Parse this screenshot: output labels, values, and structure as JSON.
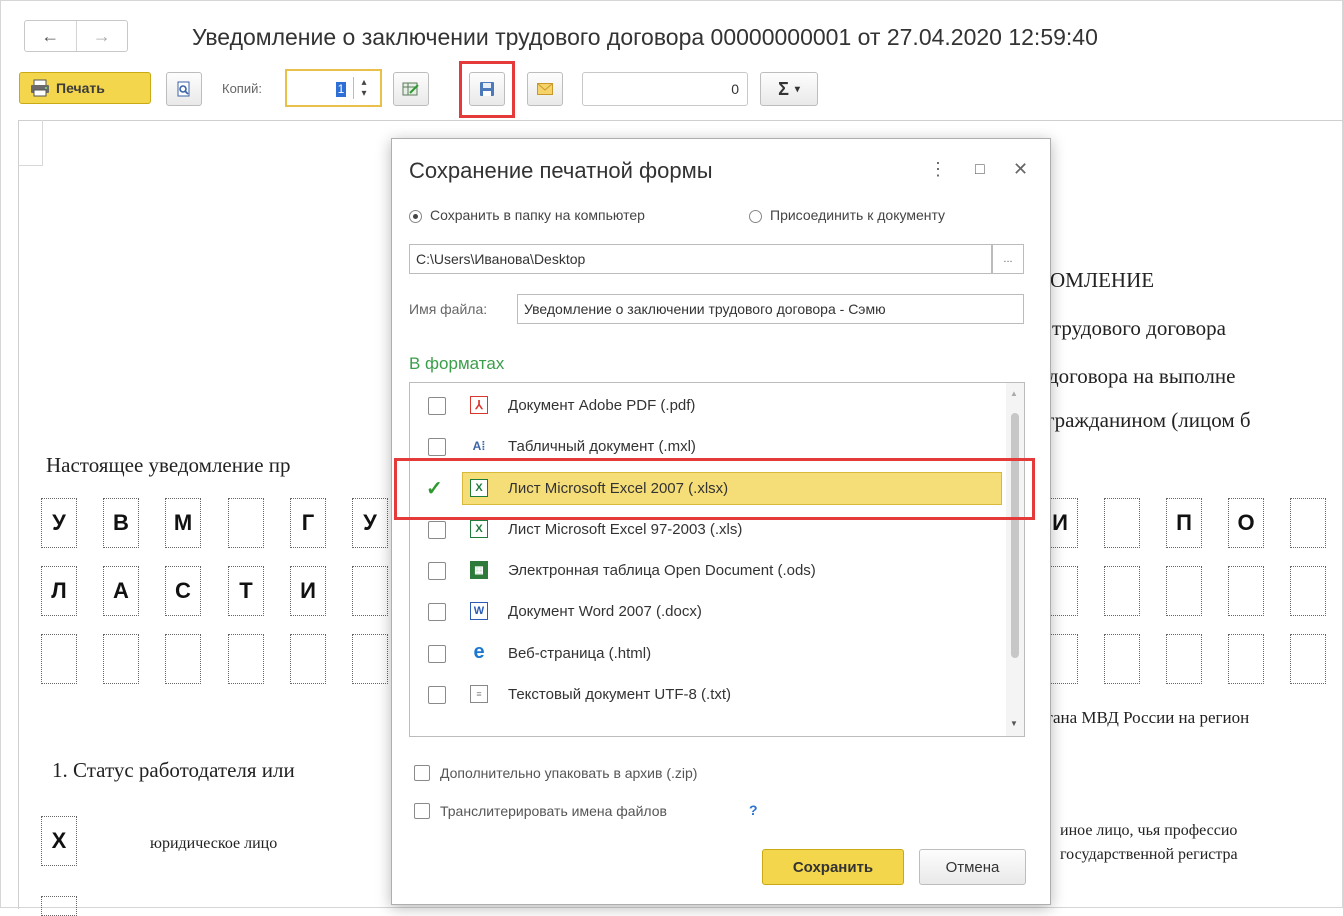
{
  "header": {
    "back_icon": "←",
    "forward_icon": "→",
    "title": "Уведомление о заключении трудового договора 00000000001 от 27.04.2020 12:59:40"
  },
  "toolbar": {
    "print_label": "Печать",
    "copies_label": "Копий:",
    "copies_value": "1",
    "counter_value": "0",
    "sigma_label": "Σ"
  },
  "document": {
    "heading_fragment": "ОМЛЕНИЕ",
    "line1_fragment": "трудового договора",
    "line2_fragment": "договора на выполне",
    "line3_fragment": "гражданином (лицом б",
    "intro_fragment": "Настоящее уведомление пр",
    "row1_letters": [
      "У",
      "В",
      "М",
      "",
      "Г",
      "У"
    ],
    "row1_right_letters": [
      "И",
      "",
      "П",
      "О",
      ""
    ],
    "row2_letters": [
      "Л",
      "А",
      "С",
      "Т",
      "И",
      ""
    ],
    "mvd_fragment": "гана МВД России на регион",
    "section1_fragment": "1. Статус работодателя или",
    "x_mark": "Х",
    "legal_entity": "юридическое лицо",
    "other_person_fragment": "иное лицо, чья профессио",
    "state_reg_fragment": "государственной регистра"
  },
  "dialog": {
    "title": "Сохранение печатной формы",
    "menu_icon": "⋮",
    "maximize_icon": "□",
    "close_icon": "✕",
    "radio_save_to_folder": "Сохранить в папку на компьютер",
    "radio_attach": "Присоединить к документу",
    "path_value": "C:\\Users\\Иванова\\Desktop",
    "path_button": "...",
    "filename_label": "Имя файла:",
    "filename_value": "Уведомление о заключении трудового договора  - Сэмю",
    "formats_heading": "В форматах",
    "formats": [
      {
        "label": "Документ Adobe PDF (.pdf)",
        "icon": "pdf-icon",
        "checked": false
      },
      {
        "label": "Табличный документ (.mxl)",
        "icon": "mxl-icon",
        "checked": false
      },
      {
        "label": "Лист Microsoft Excel 2007 (.xlsx)",
        "icon": "excel-icon",
        "checked": true
      },
      {
        "label": "Лист Microsoft Excel 97-2003 (.xls)",
        "icon": "excel-icon",
        "checked": false
      },
      {
        "label": "Электронная таблица Open Document (.ods)",
        "icon": "ods-icon",
        "checked": false
      },
      {
        "label": "Документ Word 2007 (.docx)",
        "icon": "word-icon",
        "checked": false
      },
      {
        "label": "Веб-страница (.html)",
        "icon": "edge-icon",
        "checked": false
      },
      {
        "label": "Текстовый документ UTF-8 (.txt)",
        "icon": "txt-icon",
        "checked": false
      }
    ],
    "zip_label": "Дополнительно упаковать в архив (.zip)",
    "translit_label": "Транслитерировать имена файлов",
    "help_mark": "?",
    "save_label": "Сохранить",
    "cancel_label": "Отмена"
  },
  "colors": {
    "accent_yellow": "#f3d64b",
    "highlight_red": "#e43a3a",
    "section_green": "#3a9e4a"
  }
}
